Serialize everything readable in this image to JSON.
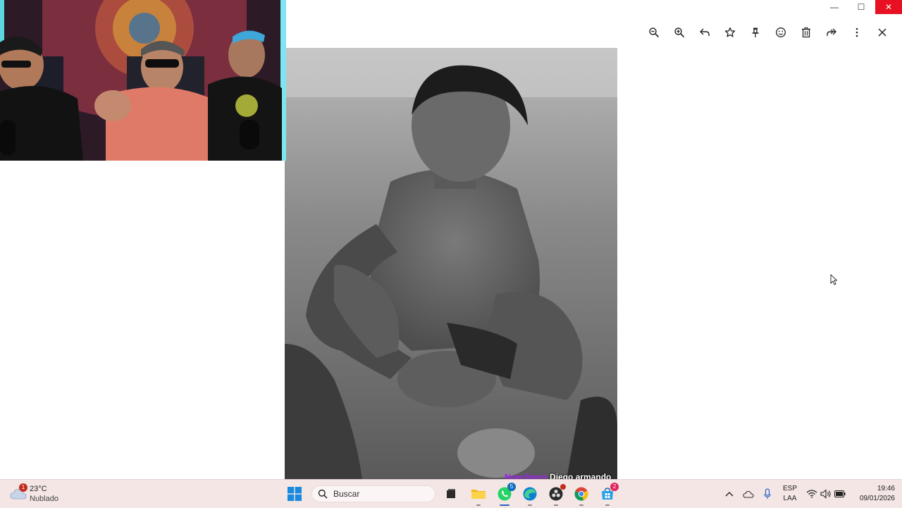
{
  "window": {
    "minimize_glyph": "—",
    "maximize_glyph": "☐",
    "close_glyph": "✕"
  },
  "toolbar": {
    "icons": [
      "zoom-out-icon",
      "zoom-in-icon",
      "reply-icon",
      "star-icon",
      "pin-icon",
      "emoji-icon",
      "trash-icon",
      "forward-icon",
      "more-icon",
      "close-icon"
    ]
  },
  "chat_caption": {
    "username": "Noeclivers",
    "message": " Diego armando"
  },
  "taskbar": {
    "weather": {
      "badge": "1",
      "temperature": "23°C",
      "condition": "Nublado"
    },
    "search_placeholder": "Buscar",
    "whatsapp_badge": "5",
    "store_badge": "2",
    "language": {
      "code": "ESP",
      "layout": "LAA"
    },
    "clock": {
      "time": "19:46",
      "date": "09/01/2026"
    }
  },
  "colors": {
    "close_red": "#e81123",
    "taskbar_bg": "#f3e6e4",
    "caption_user": "#a020f0",
    "badge_red": "#c42b1c",
    "badge_blue": "#0f6cbd"
  }
}
